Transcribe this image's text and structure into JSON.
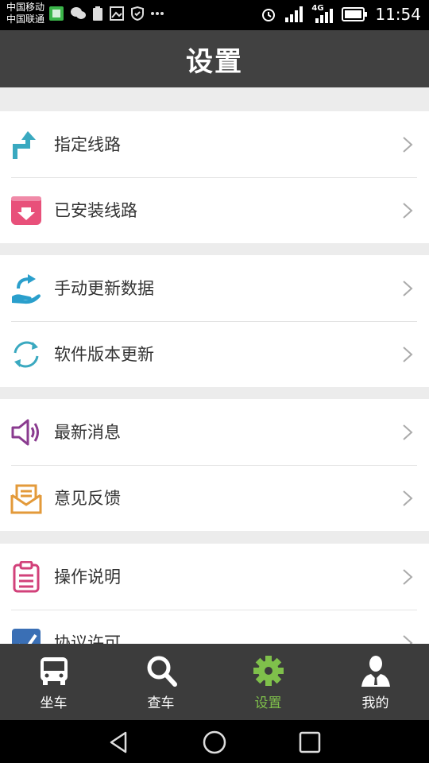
{
  "status_bar": {
    "carrier_1": "中国移动",
    "carrier_2": "中国联通",
    "network": "4G",
    "time": "11:54"
  },
  "header": {
    "title": "设置"
  },
  "groups": [
    {
      "items": [
        {
          "label": "指定线路",
          "icon": "route-arrow-icon",
          "color": "#3aa9c0"
        },
        {
          "label": "已安装线路",
          "icon": "download-box-icon",
          "color": "#e8507a"
        }
      ]
    },
    {
      "items": [
        {
          "label": "手动更新数据",
          "icon": "hand-refresh-icon",
          "color": "#2a9fcc"
        },
        {
          "label": "软件版本更新",
          "icon": "sync-icon",
          "color": "#3aa9c0"
        }
      ]
    },
    {
      "items": [
        {
          "label": "最新消息",
          "icon": "speaker-icon",
          "color": "#8a3b8f"
        },
        {
          "label": "意见反馈",
          "icon": "envelope-icon",
          "color": "#e39a3a"
        }
      ]
    },
    {
      "items": [
        {
          "label": "操作说明",
          "icon": "clipboard-icon",
          "color": "#d2417a"
        },
        {
          "label": "协议许可",
          "icon": "checkbox-icon",
          "color": "#3a6fb5"
        }
      ]
    }
  ],
  "tabs": [
    {
      "label": "坐车",
      "icon": "bus-icon",
      "active": false
    },
    {
      "label": "查车",
      "icon": "search-icon",
      "active": false
    },
    {
      "label": "设置",
      "icon": "gear-icon",
      "active": true
    },
    {
      "label": "我的",
      "icon": "user-icon",
      "active": false
    }
  ],
  "colors": {
    "header_bg": "#414141",
    "tab_active": "#7fc04b",
    "tabbar_bg": "#3c3c3c"
  }
}
